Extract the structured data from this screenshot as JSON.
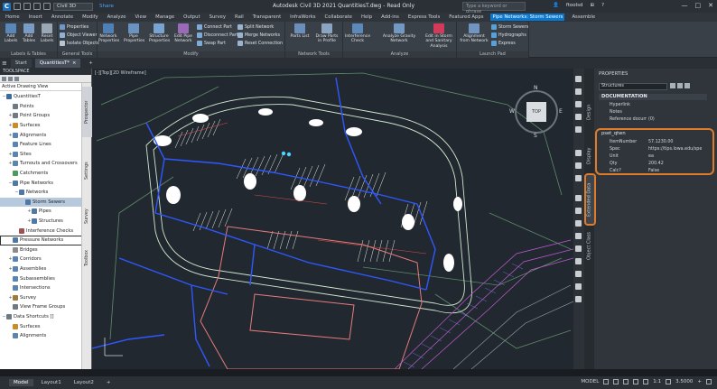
{
  "titlebar": {
    "app_letter": "C",
    "workspace": "Civil 3D",
    "share": "Share",
    "title": "Autodesk Civil 3D 2021   QuantitiesT.dwg - Read Only",
    "search_placeholder": "Type a keyword or phrase",
    "user": "ftoolsd",
    "min": "—",
    "max": "□",
    "close": "✕"
  },
  "ribbon_tabs": [
    "Home",
    "Insert",
    "Annotate",
    "Modify",
    "Analyze",
    "View",
    "Manage",
    "Output",
    "Survey",
    "Rail",
    "Transparent",
    "InfraWorks",
    "Collaborate",
    "Help",
    "Add-ins",
    "Express Tools",
    "Featured Apps",
    "Pipe Networks: Storm Sewers",
    "Assemble"
  ],
  "ribbon_active_tab": "Pipe Networks: Storm Sewers",
  "ribbon": {
    "labels_tables": {
      "title": "Labels & Tables",
      "buttons": [
        "Add Labels",
        "Add Tables",
        "Reset Labels"
      ]
    },
    "general_tools": {
      "title": "General Tools",
      "items": [
        "Properties",
        "Object Viewer",
        "Isolate Objects"
      ]
    },
    "modify": {
      "title": "Modify",
      "big": [
        "Network Properties",
        "Pipe Properties",
        "Structure Properties",
        "Edit Pipe Network"
      ],
      "small": [
        "Connect Part",
        "Disconnect Part",
        "Swap Part",
        "Split Network",
        "Merge Networks",
        "Reset Connection"
      ]
    },
    "network_tools": {
      "title": "Network Tools",
      "big": [
        "Parts List",
        "Draw Parts in Profile"
      ]
    },
    "analyze": {
      "title": "Analyze",
      "big": [
        "Interference Check",
        "Analyze Gravity Network",
        "Edit in Storm and Sanitary Analysis"
      ]
    },
    "launch_pad": {
      "title": "Launch Pad",
      "big": [
        "Alignment from Network"
      ],
      "small": [
        "Storm Sewers",
        "Hydrographs",
        "Express"
      ]
    }
  },
  "file_tabs": [
    "Start",
    "QuantitiesT*",
    "+"
  ],
  "toolspace": {
    "header": "TOOLSPACE",
    "view": "Active Drawing View",
    "tree": [
      {
        "label": "QuantitiesT",
        "level": 0,
        "exp": "−",
        "color": "#3b6aa0"
      },
      {
        "label": "Points",
        "level": 1,
        "exp": "",
        "color": "#6d7a86"
      },
      {
        "label": "Point Groups",
        "level": 1,
        "exp": "+",
        "color": "#6d7a86"
      },
      {
        "label": "Surfaces",
        "level": 1,
        "exp": "+",
        "color": "#c98b2c"
      },
      {
        "label": "Alignments",
        "level": 1,
        "exp": "+",
        "color": "#5b84b1"
      },
      {
        "label": "Feature Lines",
        "level": 1,
        "exp": "",
        "color": "#5b84b1"
      },
      {
        "label": "Sites",
        "level": 1,
        "exp": "+",
        "color": "#5b84b1"
      },
      {
        "label": "Turnouts and Crossovers",
        "level": 1,
        "exp": "+",
        "color": "#5b84b1"
      },
      {
        "label": "Catchments",
        "level": 1,
        "exp": "",
        "color": "#4e9a5c"
      },
      {
        "label": "Pipe Networks",
        "level": 1,
        "exp": "−",
        "color": "#4f78a6"
      },
      {
        "label": "Networks",
        "level": 2,
        "exp": "−",
        "color": "#4f78a6"
      },
      {
        "label": "Storm Sewers",
        "level": 3,
        "exp": "",
        "color": "#4f78a6",
        "selected": true
      },
      {
        "label": "Pipes",
        "level": 4,
        "exp": "+",
        "color": "#4f78a6"
      },
      {
        "label": "Structures",
        "level": 4,
        "exp": "+",
        "color": "#4f78a6"
      },
      {
        "label": "Interference Checks",
        "level": 2,
        "exp": "",
        "color": "#a05050"
      },
      {
        "label": "Pressure Networks",
        "level": 1,
        "exp": "",
        "color": "#4f78a6",
        "boxed": true
      },
      {
        "label": "Bridges",
        "level": 1,
        "exp": "",
        "color": "#8b8b8b"
      },
      {
        "label": "Corridors",
        "level": 1,
        "exp": "+",
        "color": "#5b84b1"
      },
      {
        "label": "Assemblies",
        "level": 1,
        "exp": "+",
        "color": "#5b84b1"
      },
      {
        "label": "Subassemblies",
        "level": 1,
        "exp": "",
        "color": "#5b84b1"
      },
      {
        "label": "Intersections",
        "level": 1,
        "exp": "",
        "color": "#5b84b1"
      },
      {
        "label": "Survey",
        "level": 1,
        "exp": "+",
        "color": "#a07a3c"
      },
      {
        "label": "View Frame Groups",
        "level": 1,
        "exp": "",
        "color": "#6d7a86"
      },
      {
        "label": "Data Shortcuts []",
        "level": 0,
        "exp": "−",
        "color": "#6d7a86"
      },
      {
        "label": "Surfaces",
        "level": 1,
        "exp": "",
        "color": "#c98b2c"
      },
      {
        "label": "Alignments",
        "level": 1,
        "exp": "",
        "color": "#5b84b1"
      }
    ],
    "side_tabs": [
      "Prospector",
      "Settings",
      "Survey",
      "Toolbox"
    ]
  },
  "viewport": {
    "label": "[-][Top][2D Wireframe]",
    "compass": {
      "n": "N",
      "s": "S",
      "e": "E",
      "w": "W",
      "top": "TOP"
    }
  },
  "properties": {
    "title": "PROPERTIES",
    "selector": "Structures",
    "vtabs": [
      "Design",
      "Display",
      "Extended Data",
      "Object Class"
    ],
    "sections": {
      "documentation": {
        "title": "DOCUMENTATION",
        "rows": [
          {
            "k": "Hyperlink",
            "v": ""
          },
          {
            "k": "Notes",
            "v": ""
          },
          {
            "k": "Reference docume...",
            "v": "(0)"
          }
        ]
      },
      "pset": {
        "title": "pset_qtwn",
        "rows": [
          {
            "k": "ItemNumber",
            "v": "57.1230.00"
          },
          {
            "k": "Spec",
            "v": "https://tips.lowa.edu/spe"
          },
          {
            "k": "Unit",
            "v": "ea"
          },
          {
            "k": "Qty",
            "v": "200.42"
          },
          {
            "k": "Calc?",
            "v": "False"
          }
        ]
      }
    }
  },
  "statusbar": {
    "tabs": [
      "Model",
      "Layout1",
      "Layout2"
    ],
    "add": "+",
    "right": [
      "MODEL",
      "1:1",
      "3.5000",
      "+"
    ]
  }
}
